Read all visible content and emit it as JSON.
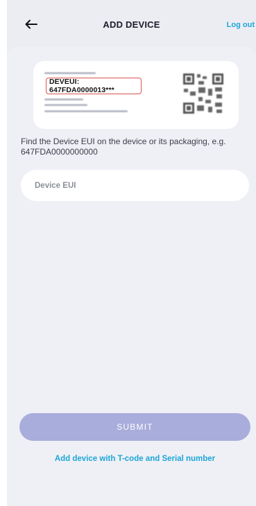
{
  "header": {
    "title": "ADD DEVICE",
    "logout_label": "Log out",
    "back_icon": "arrow-left-icon"
  },
  "illustration": {
    "eui_label": "DEVEUI: 647FDA0000013***",
    "qr_icon": "qr-code-icon"
  },
  "hint_text": "Find the Device EUI on the device or its packaging, e.g. 647FDA0000000000",
  "eui_field": {
    "placeholder": "Device EUI",
    "value": ""
  },
  "submit_label": "SUBMIT",
  "tcode_link_label": "Add device with T-code and Serial number",
  "colors": {
    "accent": "#1da6d8",
    "submit_disabled": "#a9addb",
    "background": "#eff0f5"
  }
}
